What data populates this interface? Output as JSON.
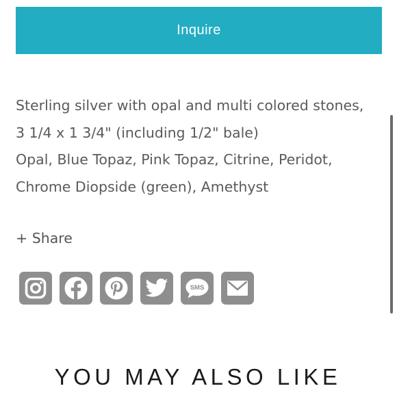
{
  "inquire": {
    "label": "Inquire"
  },
  "description": {
    "lines": [
      "Sterling silver with opal and multi colored stones,",
      "3 1/4 x 1 3/4\" (including 1/2\" bale)",
      "Opal, Blue Topaz, Pink Topaz, Citrine, Peridot,",
      "Chrome Diopside (green), Amethyst"
    ]
  },
  "share": {
    "label": "+ Share",
    "icons": [
      "instagram-icon",
      "facebook-icon",
      "pinterest-icon",
      "twitter-icon",
      "sms-icon",
      "email-icon"
    ],
    "sms_text": "SMS"
  },
  "related": {
    "heading": "YOU MAY ALSO LIKE"
  },
  "colors": {
    "accent": "#22adc3",
    "icon_gray": "#8e8e8e",
    "body_text": "#5a5a5a"
  }
}
